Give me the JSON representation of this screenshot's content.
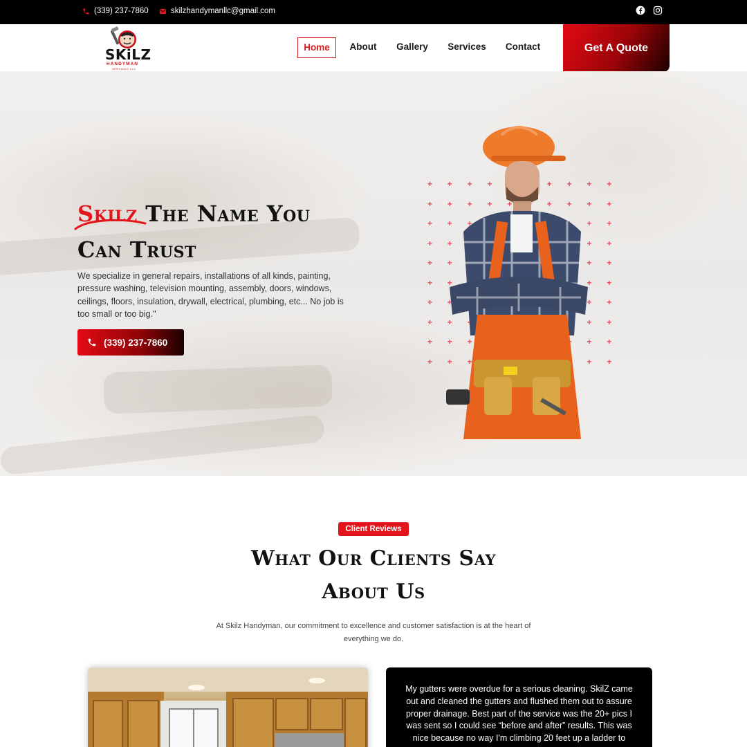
{
  "topbar": {
    "phone": "(339) 237-7860",
    "email": "skilzhandymanllc@gmail.com",
    "phone_icon": "phone-icon",
    "email_icon": "envelope-icon",
    "social": [
      "facebook-icon",
      "instagram-icon"
    ]
  },
  "header": {
    "logo_text": "SKiLZ",
    "logo_sub": "HANDYMAN",
    "logo_sub2": "SERVICES LLC",
    "nav": [
      "Home",
      "About",
      "Gallery",
      "Services",
      "Contact"
    ],
    "active_nav": "Home",
    "quote_label": "Get A Quote"
  },
  "hero": {
    "title_brand": "Skilz",
    "title_rest_line1": "The Name You",
    "title_line2": "Can Trust",
    "description": "We specialize in general repairs, installations of all kinds, painting, pressure washing, television mounting, assembly, doors, windows, ceilings, floors, insulation, drywall, electrical, plumbing, etc... No job is too small or too big.\"",
    "call_label": "(339) 237-7860"
  },
  "reviews": {
    "badge": "Client Reviews",
    "title_line1": "What Our Clients Say",
    "title_line2": "About Us",
    "description": "At Skilz Handyman, our commitment to excellence and customer satisfaction is at the heart of everything we do.",
    "review_text": "My gutters were overdue for a serious cleaning. SkilZ came out and cleaned the gutters and flushed them out to assure proper drainage. Best part of the service was the 20+ pics I was sent so I could see “before and after” results. This was nice because no way I'm climbing 20 feet up a ladder to"
  },
  "colors": {
    "accent": "#e3141c",
    "topbar": "#000000",
    "text": "#111111"
  }
}
